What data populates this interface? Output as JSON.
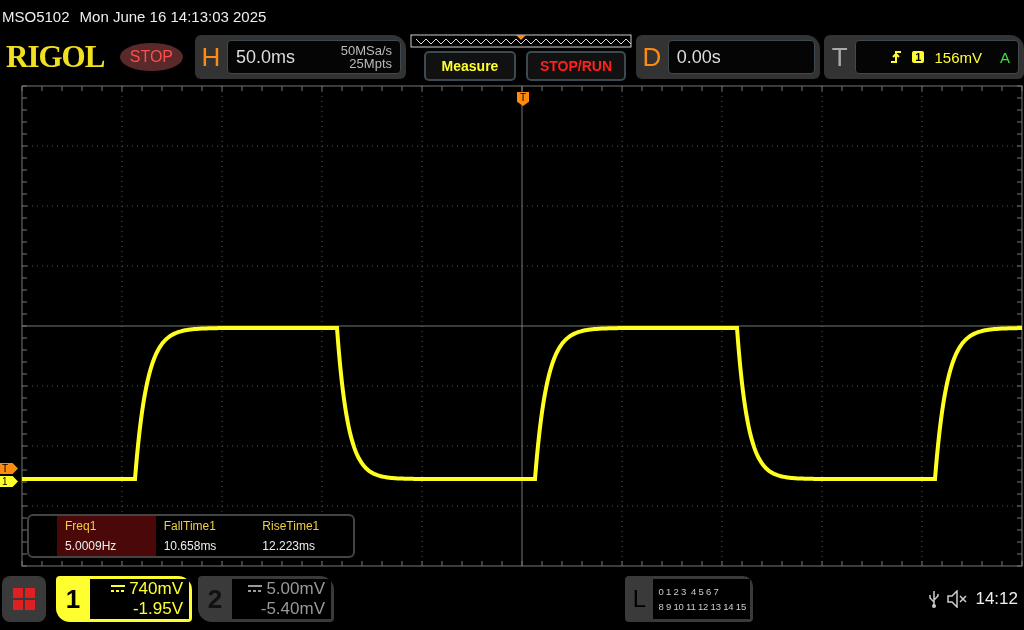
{
  "title_bar": {
    "model": "MSO5102",
    "datetime": "Mon June 16 14:13:03 2025"
  },
  "toolbar": {
    "logo": "RIGOL",
    "run_state": "STOP",
    "horizontal": {
      "label": "H",
      "timebase": "50.0ms",
      "sample_rate": "50MSa/s",
      "memory_depth": "25Mpts"
    },
    "buttons": [
      {
        "label": "Measure",
        "kind": "measure"
      },
      {
        "label": "STOP/RUN",
        "kind": "stoprun"
      }
    ],
    "delay": {
      "label": "D",
      "value": "0.00s"
    },
    "trigger": {
      "label": "T",
      "rising_edge": true,
      "source": "1",
      "level": "156mV",
      "mode": "A"
    }
  },
  "plot": {
    "trigger_position_label": "T",
    "left_markers": [
      {
        "label": "T",
        "kind": "trigger"
      },
      {
        "label": "1",
        "kind": "channel"
      }
    ]
  },
  "measurements": [
    {
      "name": "Freq1",
      "value": "5.0009Hz",
      "selected": true
    },
    {
      "name": "FallTime1",
      "value": "10.658ms",
      "selected": false
    },
    {
      "name": "RiseTime1",
      "value": "12.223ms",
      "selected": false
    }
  ],
  "channels": [
    {
      "number": "1",
      "scale": "740mV",
      "offset": "-1.95V",
      "enabled": true
    },
    {
      "number": "2",
      "scale": "5.00mV",
      "offset": "-5.40mV",
      "enabled": false
    }
  ],
  "logic": {
    "label": "L",
    "row_1": "0 1 2 3  4 5 6 7",
    "row_2": "8 9 10 11 12 13 14 15"
  },
  "status": {
    "muted": true,
    "clock": "14:12"
  }
}
